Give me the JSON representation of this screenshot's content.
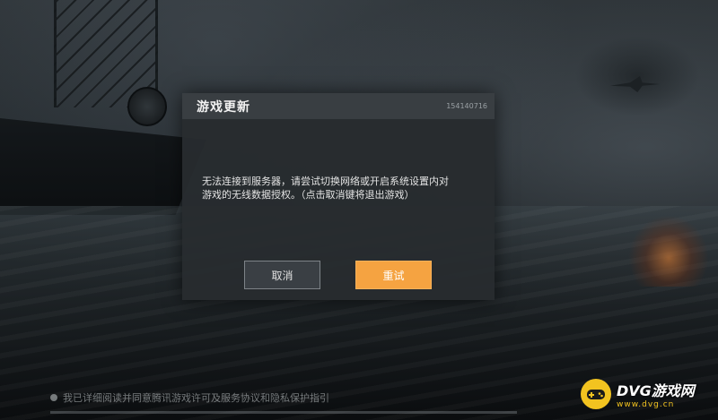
{
  "dialog": {
    "title": "游戏更新",
    "code": "154140716",
    "message_line1": "无法连接到服务器，请尝试切换网络或开启系统设置内对",
    "message_line2": "游戏的无线数据授权。（点击取消键将退出游戏）",
    "cancel_label": "取消",
    "retry_label": "重试"
  },
  "footer": {
    "agreement_text": "我已详细阅读并同意腾讯游戏许可及服务协议和隐私保护指引"
  },
  "watermark": {
    "main": "DVG游戏网",
    "sub": "www.dvg.cn"
  },
  "colors": {
    "accent": "#f5a341",
    "dialog_bg": "#282c2f",
    "watermark_yellow": "#f2c320"
  },
  "icons": [
    "radio-check-icon",
    "gamepad-logo-icon"
  ]
}
